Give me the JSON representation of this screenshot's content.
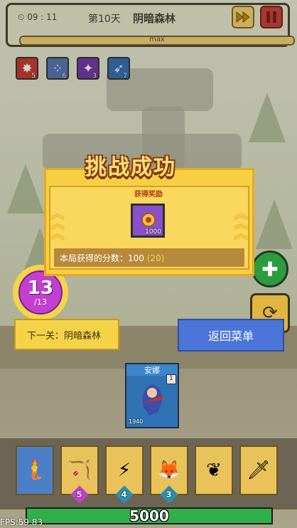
{
  "topbar": {
    "time": "09 : 11",
    "day": "第10天",
    "stage": "阴暗森林",
    "progress_label": "max",
    "progress_fraction": 1.0
  },
  "skills": [
    {
      "icon": "fist-burst-icon",
      "count": "5",
      "color": "#c2332b"
    },
    {
      "icon": "egg-cluster-icon",
      "count": "6",
      "color": "#4f6fb2"
    },
    {
      "icon": "purple-blast-icon",
      "count": "3",
      "color": "#6b2fa6"
    },
    {
      "icon": "ice-arrows-icon",
      "count": "7",
      "color": "#2b6ab3"
    }
  ],
  "result": {
    "title": "挑战成功",
    "reward_label": "获得奖励",
    "reward_item": {
      "icon": "gold-coin-icon",
      "quantity": "1000"
    },
    "score_prefix": "本局获得的分数：",
    "score": "100",
    "score_bonus": "(20)"
  },
  "wave": {
    "current": "13",
    "total": "/13"
  },
  "next_stage": "下一关：阴暗森林",
  "return_button": "返回菜单",
  "hero_card": {
    "name": "安娜",
    "level": "1",
    "power": "1940"
  },
  "hand_cards": [
    {
      "icon": "blue-hero-icon",
      "cost": ""
    },
    {
      "icon": "crossbow-icon",
      "cost": "5"
    },
    {
      "icon": "lightning-icon",
      "cost": "4"
    },
    {
      "icon": "fox-mage-icon",
      "cost": "3"
    },
    {
      "icon": "green-spirit-icon",
      "cost": ""
    },
    {
      "icon": "sword-icon",
      "cost": ""
    }
  ],
  "energy": {
    "value": "5000",
    "fraction": 1.0
  },
  "fps": "FPS:59.83",
  "colors": {
    "panel": "#f6cf45",
    "accent_red": "#c63a33",
    "button_blue": "#4b75d8",
    "energy_green": "#2fb04a"
  }
}
